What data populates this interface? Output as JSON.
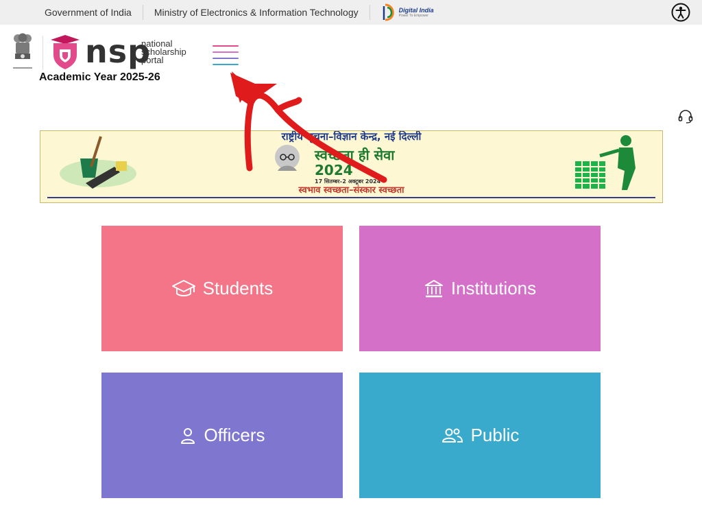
{
  "gov_bar": {
    "government": "Government of India",
    "ministry": "Ministry of Electronics & Information Technology",
    "digital_india": {
      "title": "Digital India",
      "tagline": "Power To Empower"
    },
    "accessibility_icon": "accessibility-icon"
  },
  "header": {
    "logo_word": "nsp",
    "logo_tag": [
      "national",
      "scholarship",
      "portal"
    ],
    "academic_year": "Academic Year 2025-26",
    "menu_icon": "hamburger-menu-icon",
    "help_icon": "headset-icon"
  },
  "banner": {
    "top_text": "राष्ट्रीय सूचना–विज्ञान केन्द्र, नई दिल्ली",
    "main_title": "स्वच्छता ही सेवा 2024",
    "dates": "17 सितम्बर–2 अक्टूबर 2024",
    "bottom_text": "स्वभाव स्वच्छता–संस्कार स्वच्छता"
  },
  "tiles": [
    {
      "label": "Students",
      "icon": "graduation-cap-icon",
      "color": "#f47587"
    },
    {
      "label": "Institutions",
      "icon": "institution-building-icon",
      "color": "#d470c8"
    },
    {
      "label": "Officers",
      "icon": "officer-person-icon",
      "color": "#7f76d0"
    },
    {
      "label": "Public",
      "icon": "people-group-icon",
      "color": "#39a9cc"
    }
  ],
  "colors": {
    "brand_pink": "#e24a8b",
    "annotation_red": "#e01b1b"
  }
}
